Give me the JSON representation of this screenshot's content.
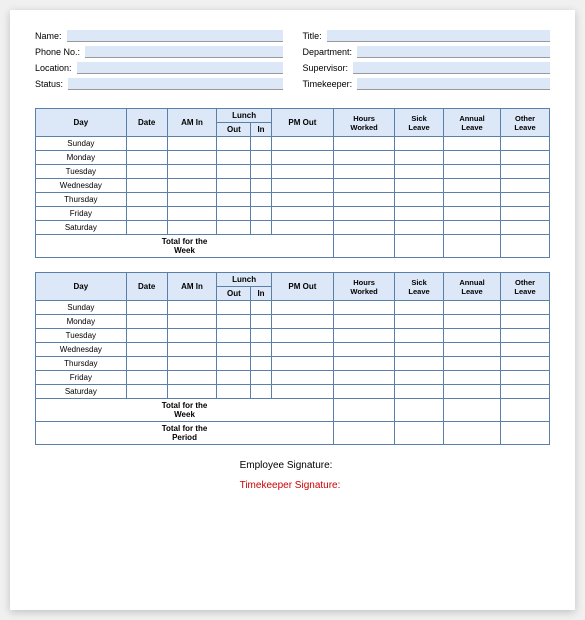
{
  "form": {
    "left": [
      {
        "label": "Name:",
        "id": "name"
      },
      {
        "label": "Phone No.:",
        "id": "phone"
      },
      {
        "label": "Location:",
        "id": "location"
      },
      {
        "label": "Status:",
        "id": "status"
      }
    ],
    "right": [
      {
        "label": "Title:",
        "id": "title"
      },
      {
        "label": "Department:",
        "id": "department"
      },
      {
        "label": "Supervisor:",
        "id": "supervisor"
      },
      {
        "label": "Timekeeper:",
        "id": "timekeeper"
      }
    ]
  },
  "table": {
    "headers": {
      "day": "Day",
      "date": "Date",
      "am_in": "AM In",
      "lunch_out": "Out",
      "lunch_in": "In",
      "pm_out": "PM Out",
      "hours_worked": "Hours Worked",
      "sick_leave": "Sick Leave",
      "annual_leave": "Annual Leave",
      "other_leave": "Other Leave",
      "lunch": "Lunch"
    },
    "days": [
      "Sunday",
      "Monday",
      "Tuesday",
      "Wednesday",
      "Thursday",
      "Friday",
      "Saturday"
    ],
    "total_week_label": "Total for the Week",
    "total_period_label": "Total for the Period"
  },
  "signatures": {
    "employee_label": "Employee Signature:",
    "timekeeper_label": "Timekeeper Signature:"
  }
}
